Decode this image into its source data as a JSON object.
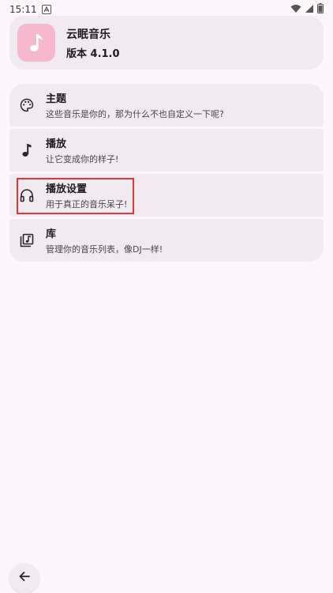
{
  "status_bar": {
    "time": "15:11"
  },
  "app": {
    "name": "云眠音乐",
    "version": "版本 4.1.0"
  },
  "settings": {
    "items": [
      {
        "title": "主题",
        "desc": "这些音乐是你的，那为什么不也自定义一下呢?",
        "icon": "palette-icon"
      },
      {
        "title": "播放",
        "desc": "让它变成你的样子!",
        "icon": "music-note-icon"
      },
      {
        "title": "播放设置",
        "desc": "用于真正的音乐呆子!",
        "icon": "headphones-icon"
      },
      {
        "title": "库",
        "desc": "管理你的音乐列表，像DJ一样!",
        "icon": "library-music-icon"
      }
    ]
  },
  "colors": {
    "background": "#fdf7fb",
    "card": "#f2eaf1",
    "app_icon": "#f5b8cd",
    "highlight": "#d93a3a"
  }
}
